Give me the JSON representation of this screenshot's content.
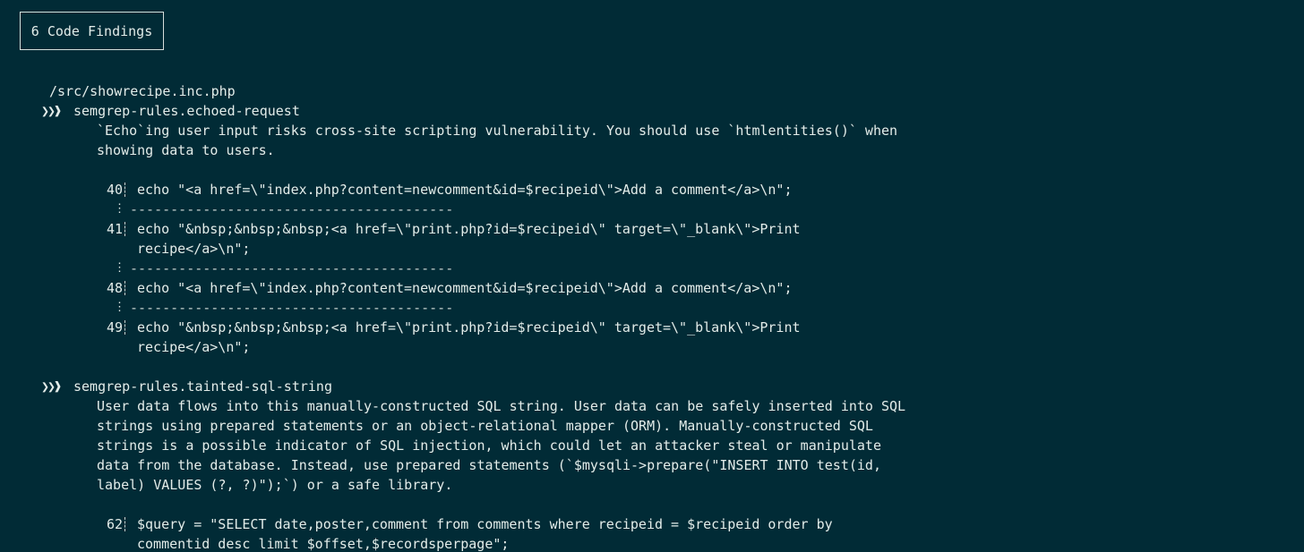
{
  "header": {
    "findings_label": "6 Code Findings"
  },
  "file": {
    "path": "/src/showrecipe.inc.php"
  },
  "chevron": "❯❯❱",
  "separator": "----------------------------------------",
  "findings": [
    {
      "rule_id": "semgrep-rules.echoed-request",
      "description": [
        "`Echo`ing user input risks cross-site scripting vulnerability. You should use `htmlentities()` when",
        "showing data to users."
      ],
      "snippets": [
        {
          "line": "40",
          "code": [
            "echo \"<a href=\\\"index.php?content=newcomment&id=$recipeid\\\">Add a comment</a>\\n\";"
          ]
        },
        {
          "line": "41",
          "code": [
            "echo \"&nbsp;&nbsp;&nbsp;<a href=\\\"print.php?id=$recipeid\\\" target=\\\"_blank\\\">Print",
            "recipe</a>\\n\";"
          ]
        },
        {
          "line": "48",
          "code": [
            "echo \"<a href=\\\"index.php?content=newcomment&id=$recipeid\\\">Add a comment</a>\\n\";"
          ]
        },
        {
          "line": "49",
          "code": [
            "echo \"&nbsp;&nbsp;&nbsp;<a href=\\\"print.php?id=$recipeid\\\" target=\\\"_blank\\\">Print",
            "recipe</a>\\n\";"
          ]
        }
      ]
    },
    {
      "rule_id": "semgrep-rules.tainted-sql-string",
      "description": [
        "User data flows into this manually-constructed SQL string. User data can be safely inserted into SQL",
        "strings using prepared statements or an object-relational mapper (ORM). Manually-constructed SQL",
        "strings is a possible indicator of SQL injection, which could let an attacker steal or manipulate",
        "data from the database. Instead, use prepared statements (`$mysqli->prepare(\"INSERT INTO test(id,",
        "label) VALUES (?, ?)\");`) or a safe library."
      ],
      "snippets": [
        {
          "line": "62",
          "code": [
            "$query = \"SELECT date,poster,comment from comments where recipeid = $recipeid order by",
            "commentid desc limit $offset,$recordsperpage\";"
          ]
        }
      ]
    }
  ]
}
